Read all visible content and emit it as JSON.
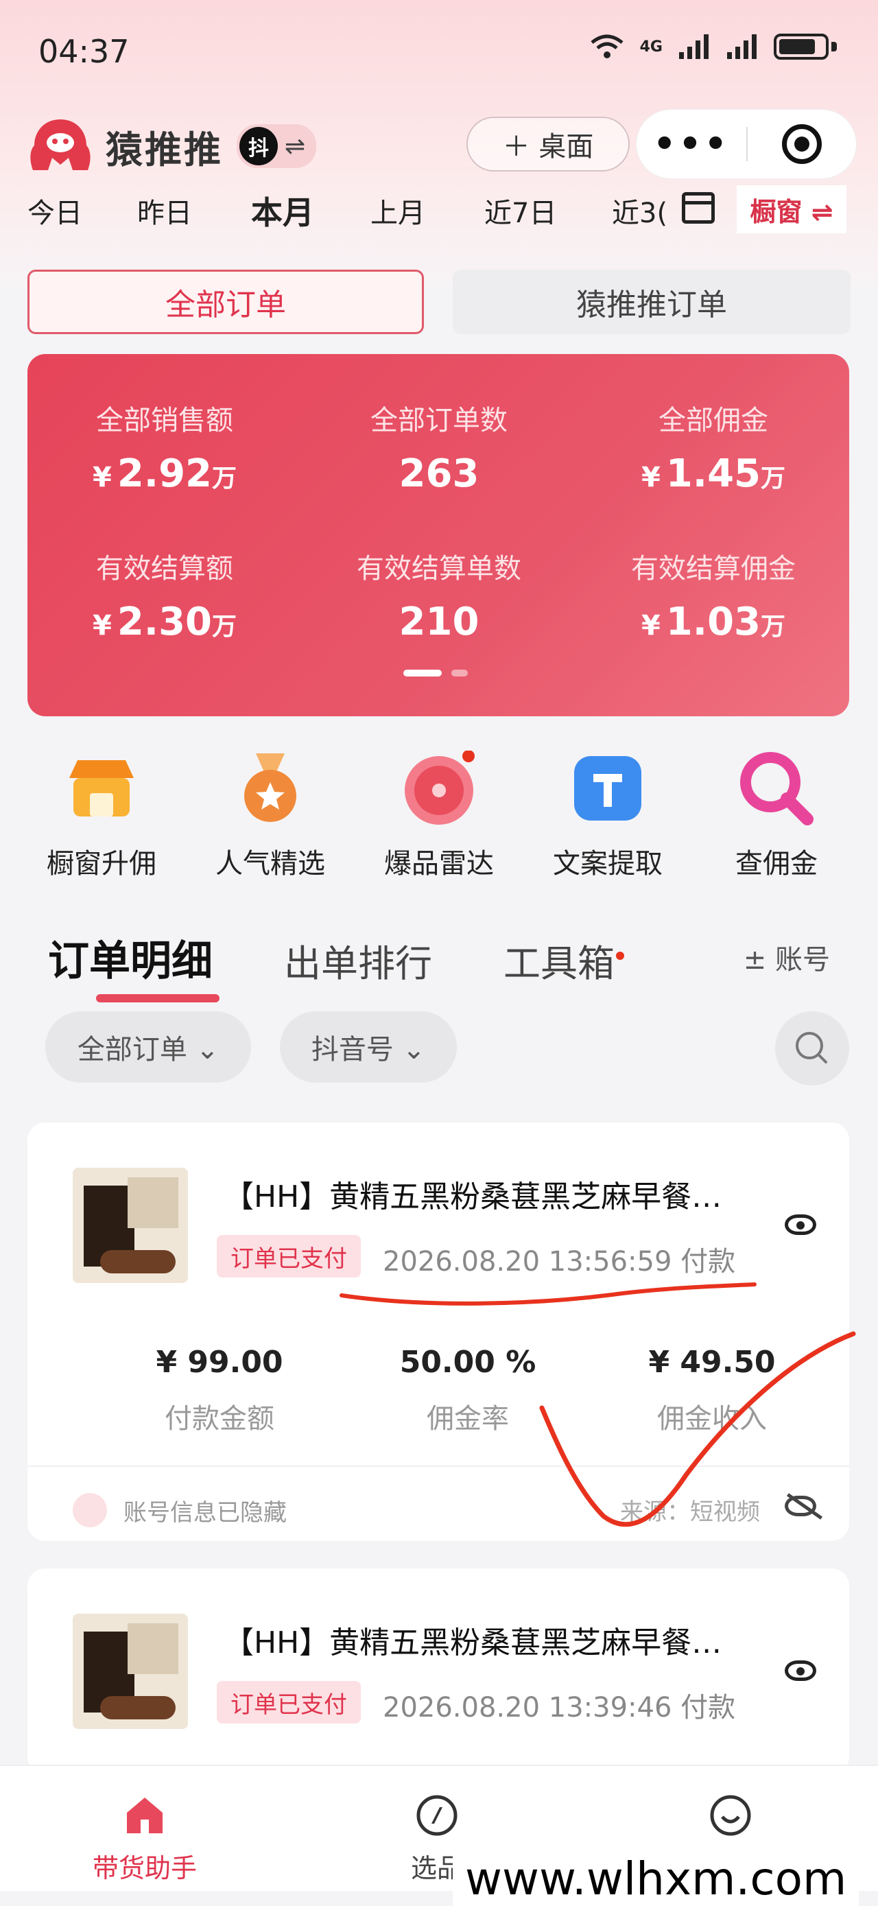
{
  "status_bar": {
    "time": "04:37",
    "network": "4G"
  },
  "header": {
    "app_name": "猿推推",
    "platform_badge": "抖",
    "swap_symbol": "⇌",
    "desktop_button": "＋ 桌面",
    "menu_dots": "•••"
  },
  "date_tabs": {
    "items": [
      "今日",
      "昨日",
      "本月",
      "上月",
      "近7日",
      "近3("
    ],
    "active": "本月",
    "window_tab": "橱窗 ⇌"
  },
  "order_toggle": {
    "all": "全部订单",
    "ytt": "猿推推订单"
  },
  "stats": [
    {
      "label": "全部销售额",
      "currency": "¥",
      "value": "2.92",
      "unit": "万"
    },
    {
      "label": "全部订单数",
      "currency": "",
      "value": "263",
      "unit": ""
    },
    {
      "label": "全部佣金",
      "currency": "¥",
      "value": "1.45",
      "unit": "万"
    },
    {
      "label": "有效结算额",
      "currency": "¥",
      "value": "2.30",
      "unit": "万"
    },
    {
      "label": "有效结算单数",
      "currency": "",
      "value": "210",
      "unit": ""
    },
    {
      "label": "有效结算佣金",
      "currency": "¥",
      "value": "1.03",
      "unit": "万"
    }
  ],
  "tools": [
    {
      "label": "橱窗升佣",
      "icon": "shop-icon",
      "color": "#f7a21a"
    },
    {
      "label": "人气精选",
      "icon": "medal-icon",
      "color": "#f08a3a"
    },
    {
      "label": "爆品雷达",
      "icon": "radar-icon",
      "color": "#e94d5c"
    },
    {
      "label": "文案提取",
      "icon": "text-extract-icon",
      "color": "#3d8df0"
    },
    {
      "label": "查佣金",
      "icon": "magnifier-icon",
      "color": "#e8459a"
    }
  ],
  "section_tabs": {
    "detail": "订单明细",
    "ranking": "出单排行",
    "toolbox": "工具箱",
    "account": "± 账号"
  },
  "filters": {
    "order_filter": "全部订单 ⌄",
    "douyin_filter": "抖音号 ⌄"
  },
  "orders": [
    {
      "title": "【HH】黄精五黑粉桑葚黑芝麻早餐…",
      "status": "订单已支付",
      "pay_time": "2026.08.20 13:56:59 付款",
      "amount": "¥ 99.00",
      "amount_label": "付款金额",
      "rate": "50.00 %",
      "rate_label": "佣金率",
      "income": "¥ 49.50",
      "income_label": "佣金收入",
      "account_hidden": "账号信息已隐藏",
      "source": "来源：短视频"
    },
    {
      "title": "【HH】黄精五黑粉桑葚黑芝麻早餐…",
      "status": "订单已支付",
      "pay_time": "2026.08.20 13:39:46 付款"
    }
  ],
  "bottom_nav": [
    {
      "label": "带货助手",
      "icon": "home-icon",
      "active": true
    },
    {
      "label": "选品",
      "icon": "compass-icon",
      "active": false
    },
    {
      "label": "",
      "icon": "smile-icon",
      "active": false
    }
  ],
  "watermark": "www.wlhxm.com",
  "colors": {
    "accent": "#e8485c",
    "stats_bg": "#e64459",
    "annotation": "#e8321e"
  }
}
